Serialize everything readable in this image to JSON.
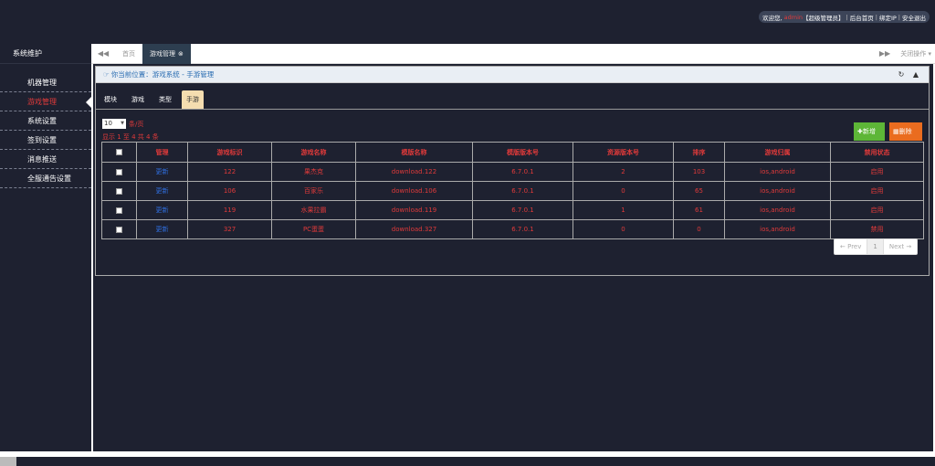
{
  "header": {
    "welcome": "欢迎您,",
    "username": "admin",
    "role": "【超级管理员】",
    "links": [
      "后台首页",
      "绑定IP",
      "安全退出"
    ]
  },
  "sidebar": {
    "title": "系统维护",
    "items": [
      {
        "label": "机器管理",
        "active": false
      },
      {
        "label": "游戏管理",
        "active": true
      },
      {
        "label": "系统设置",
        "active": false
      },
      {
        "label": "签到设置",
        "active": false
      },
      {
        "label": "消息推送",
        "active": false
      },
      {
        "label": "全服通告设置",
        "active": false
      }
    ]
  },
  "tabbar": {
    "home": "首页",
    "current": "游戏管理",
    "close_ops": "关闭操作"
  },
  "breadcrumb": "你当前位置：游戏系统 - 手游管理",
  "subtabs": [
    "模块",
    "游戏",
    "类型",
    "手游"
  ],
  "active_subtab": 3,
  "pagesize": {
    "value": "10",
    "suffix": "条/页"
  },
  "showinfo": "显示 1 至 4 共 4 条",
  "buttons": {
    "add": "新增",
    "delete": "删除"
  },
  "table": {
    "columns": [
      "管理",
      "游戏标识",
      "游戏名称",
      "模版名称",
      "模版版本号",
      "资源版本号",
      "排序",
      "游戏归属",
      "禁用状态"
    ],
    "rows": [
      {
        "action": "更新",
        "id": "122",
        "name": "果杰克",
        "template": "download.122",
        "tpl_ver": "6.7.0.1",
        "res_ver": "2",
        "sort": "103",
        "platform": "ios,android",
        "status": "启用",
        "status_alert": false
      },
      {
        "action": "更新",
        "id": "106",
        "name": "百家乐",
        "template": "download.106",
        "tpl_ver": "6.7.0.1",
        "res_ver": "0",
        "sort": "65",
        "platform": "ios,android",
        "status": "启用",
        "status_alert": false
      },
      {
        "action": "更新",
        "id": "119",
        "name": "水果拉霸",
        "template": "download.119",
        "tpl_ver": "6.7.0.1",
        "res_ver": "1",
        "sort": "61",
        "platform": "ios,android",
        "status": "启用",
        "status_alert": false
      },
      {
        "action": "更新",
        "id": "327",
        "name": "PC蛋蛋",
        "template": "download.327",
        "tpl_ver": "6.7.0.1",
        "res_ver": "0",
        "sort": "0",
        "platform": "ios,android",
        "status": "禁用",
        "status_alert": true
      }
    ]
  },
  "pager": {
    "prev": "← Prev",
    "page": "1",
    "next": "Next →"
  },
  "icons": [
    "hand-pointer-icon",
    "refresh-icon",
    "collapse-icon",
    "close-circle-icon",
    "double-left-icon",
    "double-right-icon",
    "plus-icon",
    "trash-icon",
    "caret-down-icon"
  ],
  "colors": {
    "bg": "#1e2130",
    "accent_red": "#e03a3a",
    "link_blue": "#2f6fe0",
    "add_green": "#5db637",
    "del_orange": "#ea6c1f",
    "active_subtab": "#f4ddb0"
  }
}
